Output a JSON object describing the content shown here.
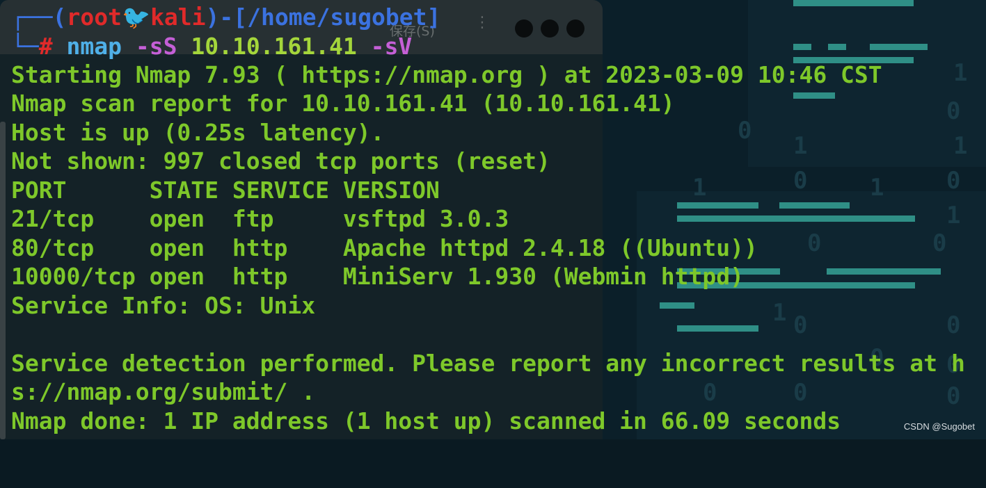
{
  "background": {
    "digits": [
      "1",
      "1",
      "0",
      "1",
      "0",
      "1",
      "1",
      "0",
      "0",
      "0",
      "1",
      "0",
      "1",
      "0",
      "0",
      "0",
      "0",
      "0",
      "0",
      "0"
    ]
  },
  "ghost_window": {
    "save_label": "保存(S)",
    "menu_glyph": "⋮"
  },
  "prompt": {
    "corner_top": "┌──(",
    "user": "root",
    "icon": "bird-icon",
    "host": "kali",
    "mid": ")-[",
    "path": "/home/sugobet",
    "close": "]",
    "corner_bottom": "└─",
    "hash": "#",
    "command": "nmap",
    "flag1": "-sS",
    "target": "10.10.161.41",
    "flag2": "-sV"
  },
  "output": {
    "starting": "Starting Nmap 7.93 ( https://nmap.org ) at 2023-03-09 10:46 CST",
    "report": "Nmap scan report for 10.10.161.41 (10.10.161.41)",
    "host_up": "Host is up (0.25s latency).",
    "not_shown": "Not shown: 997 closed tcp ports (reset)",
    "port_header": "PORT      STATE SERVICE VERSION",
    "ports": [
      "21/tcp    open  ftp     vsftpd 3.0.3",
      "80/tcp    open  http    Apache httpd 2.4.18 ((Ubuntu))",
      "10000/tcp open  http    MiniServ 1.930 (Webmin httpd)"
    ],
    "service_info": "Service Info: OS: Unix",
    "blank": "",
    "detection_1": "Service detection performed. Please report any incorrect results at h",
    "detection_2": "s://nmap.org/submit/ .",
    "done": "Nmap done: 1 IP address (1 host up) scanned in 66.09 seconds"
  },
  "watermark": "CSDN @Sugobet",
  "colors": {
    "output_green": "#7ec82a",
    "prompt_blue": "#3b72e0",
    "prompt_red": "#e02a2a",
    "flag_purple": "#c45fd6",
    "accent_teal": "#2f8f86"
  }
}
